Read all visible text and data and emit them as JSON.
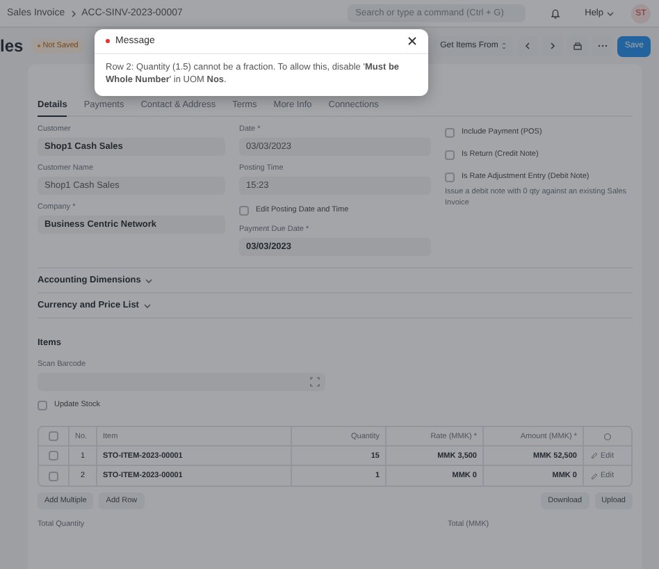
{
  "topbar": {
    "breadcrumbs": [
      "Sales Invoice",
      "ACC-SINV-2023-00007"
    ],
    "search": {
      "placeholder": "Search or type a command (Ctrl + G)"
    },
    "help": "Help",
    "avatar": "ST"
  },
  "header": {
    "title": "les",
    "status": "Not Saved",
    "get_items": "Get Items From",
    "save": "Save"
  },
  "tabs": [
    {
      "label": "Details",
      "selected": true
    },
    {
      "label": "Payments",
      "selected": false
    },
    {
      "label": "Contact & Address",
      "selected": false
    },
    {
      "label": "Terms",
      "selected": false
    },
    {
      "label": "More Info",
      "selected": false
    },
    {
      "label": "Connections",
      "selected": false
    }
  ],
  "column_1": [
    {
      "label": "Customer",
      "value": "Shop1 Cash Sales",
      "bold": true
    },
    {
      "label": "Customer Name",
      "value": "Shop1 Cash Sales",
      "bold": false
    },
    {
      "label": "Company *",
      "value": "Business Centric Network",
      "bold": true
    }
  ],
  "column_2": [
    {
      "kind": "field",
      "label": "Date *",
      "value": "03/03/2023",
      "bold": false
    },
    {
      "kind": "field",
      "label": "Posting Time",
      "value": "15:23",
      "bold": false
    },
    {
      "kind": "check",
      "label": "Edit Posting Date and Time",
      "checked": false
    },
    {
      "kind": "field",
      "label": "Payment Due Date *",
      "value": "03/03/2023",
      "bold": true
    }
  ],
  "column_3": [
    {
      "label": "Include Payment (POS)",
      "checked": false
    },
    {
      "label": "Is Return (Credit Note)",
      "checked": false
    },
    {
      "label": "Is Rate Adjustment Entry (Debit Note)",
      "checked": false,
      "description": "Issue a debit note with 0 qty against an existing Sales Invoice"
    }
  ],
  "sections": [
    {
      "title": "Accounting Dimensions",
      "expanded": false
    },
    {
      "title": "Currency and Price List",
      "expanded": false
    }
  ],
  "items": {
    "title": "Items",
    "scan_label": "Scan Barcode",
    "update_stock": {
      "label": "Update Stock",
      "checked": false
    },
    "all_checked": false,
    "columns": [
      "No.",
      "Item",
      "Quantity",
      "Rate (MMK) *",
      "Amount (MMK) *"
    ],
    "rows": [
      {
        "no": "1",
        "item": "STO-ITEM-2023-00001",
        "quantity": "15",
        "rate": "MMK 3,500",
        "amount": "MMK 52,500",
        "edit": "Edit",
        "checked": false
      },
      {
        "no": "2",
        "item": "STO-ITEM-2023-00001",
        "quantity": "1",
        "rate": "MMK 0",
        "amount": "MMK 0",
        "edit": "Edit",
        "checked": false
      }
    ],
    "buttons_left": [
      "Add Multiple",
      "Add Row"
    ],
    "buttons_right": [
      "Download",
      "Upload"
    ]
  },
  "totals": [
    "Total Quantity",
    "Total (MMK)"
  ],
  "modal": {
    "title": "Message",
    "message": "Row 2: Quantity (1.5) cannot be a fraction. To allow this, disable '**Must be Whole Number**' in UOM **Nos**."
  }
}
